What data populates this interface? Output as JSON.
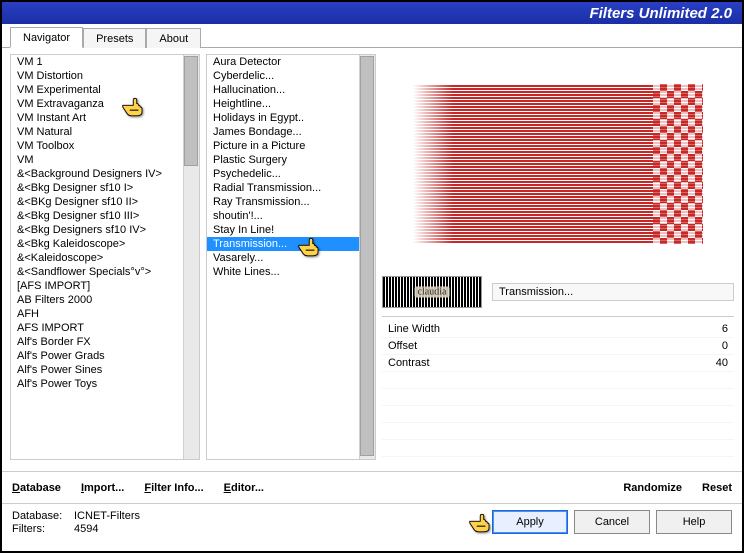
{
  "title": "Filters Unlimited 2.0",
  "tabs": [
    "Navigator",
    "Presets",
    "About"
  ],
  "active_tab": 0,
  "nav_items": [
    "VM 1",
    "VM Distortion",
    "VM Experimental",
    "VM Extravaganza",
    "VM Instant Art",
    "VM Natural",
    "VM Toolbox",
    "VM",
    "&<Background Designers IV>",
    "&<Bkg Designer sf10 I>",
    "&<BKg Designer sf10 II>",
    "&<Bkg Designer sf10 III>",
    "&<Bkg Designers sf10 IV>",
    "&<Bkg Kaleidoscope>",
    "&<Kaleidoscope>",
    "&<Sandflower Specials°v°>",
    "[AFS IMPORT]",
    "AB Filters 2000",
    "AFH",
    "AFS IMPORT",
    "Alf's Border FX",
    "Alf's Power Grads",
    "Alf's Power Sines",
    "Alf's Power Toys"
  ],
  "nav_highlight_index": 3,
  "filter_items": [
    "Aura Detector",
    "Cyberdelic...",
    "Hallucination...",
    "Heightline...",
    "Holidays in Egypt..",
    "James Bondage...",
    "Picture in a Picture",
    "Plastic Surgery",
    "Psychedelic...",
    "Radial Transmission...",
    "Ray Transmission...",
    "shoutin'!...",
    "Stay In Line!",
    "Transmission...",
    "Vasarely...",
    "White Lines..."
  ],
  "filter_selected_index": 13,
  "preview_label": "claudia",
  "filter_name": "Transmission...",
  "params": [
    {
      "label": "Line Width",
      "value": "6"
    },
    {
      "label": "Offset",
      "value": "0"
    },
    {
      "label": "Contrast",
      "value": "40"
    }
  ],
  "toolbar": {
    "database": "Database",
    "import": "Import...",
    "info": "Filter Info...",
    "editor": "Editor...",
    "randomize": "Randomize",
    "reset": "Reset"
  },
  "status": {
    "db_label": "Database:",
    "db_value": "ICNET-Filters",
    "filters_label": "Filters:",
    "filters_value": "4594"
  },
  "buttons": {
    "apply": "Apply",
    "cancel": "Cancel",
    "help": "Help"
  }
}
